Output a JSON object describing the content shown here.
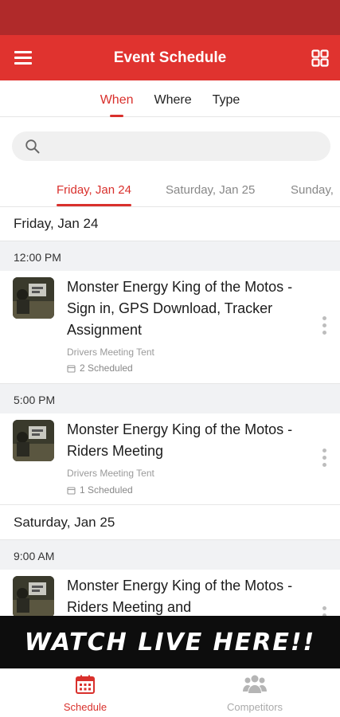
{
  "appbar": {
    "title": "Event Schedule"
  },
  "subtabs": [
    {
      "label": "When",
      "active": true
    },
    {
      "label": "Where",
      "active": false
    },
    {
      "label": "Type",
      "active": false
    }
  ],
  "search": {
    "placeholder": ""
  },
  "date_tabs": [
    {
      "label": "Friday, Jan 24",
      "active": true
    },
    {
      "label": "Saturday, Jan 25",
      "active": false
    },
    {
      "label": "Sunday,",
      "active": false
    }
  ],
  "sections": {
    "day1": "Friday, Jan 24",
    "time1": "12:00 PM",
    "time2": "5:00 PM",
    "day2": "Saturday, Jan 25",
    "time3": "9:00 AM"
  },
  "events": [
    {
      "title": "Monster Energy King of the Motos - Sign in, GPS Download, Tracker Assignment",
      "location": "Drivers Meeting Tent",
      "scheduled": "2 Scheduled"
    },
    {
      "title": "Monster Energy King of the Motos - Riders Meeting",
      "location": "Drivers Meeting Tent",
      "scheduled": "1 Scheduled"
    },
    {
      "title": "Monster Energy King of the Motos - Riders Meeting and",
      "location": "",
      "scheduled": ""
    }
  ],
  "banner": {
    "text": "WATCH LIVE HERE!!"
  },
  "bottom_nav": [
    {
      "label": "Schedule",
      "icon": "calendar-icon",
      "active": true
    },
    {
      "label": "Competitors",
      "icon": "people-icon",
      "active": false
    }
  ],
  "colors": {
    "accent": "#e0332f",
    "status_bar": "#b02a2a",
    "muted": "#888888"
  }
}
